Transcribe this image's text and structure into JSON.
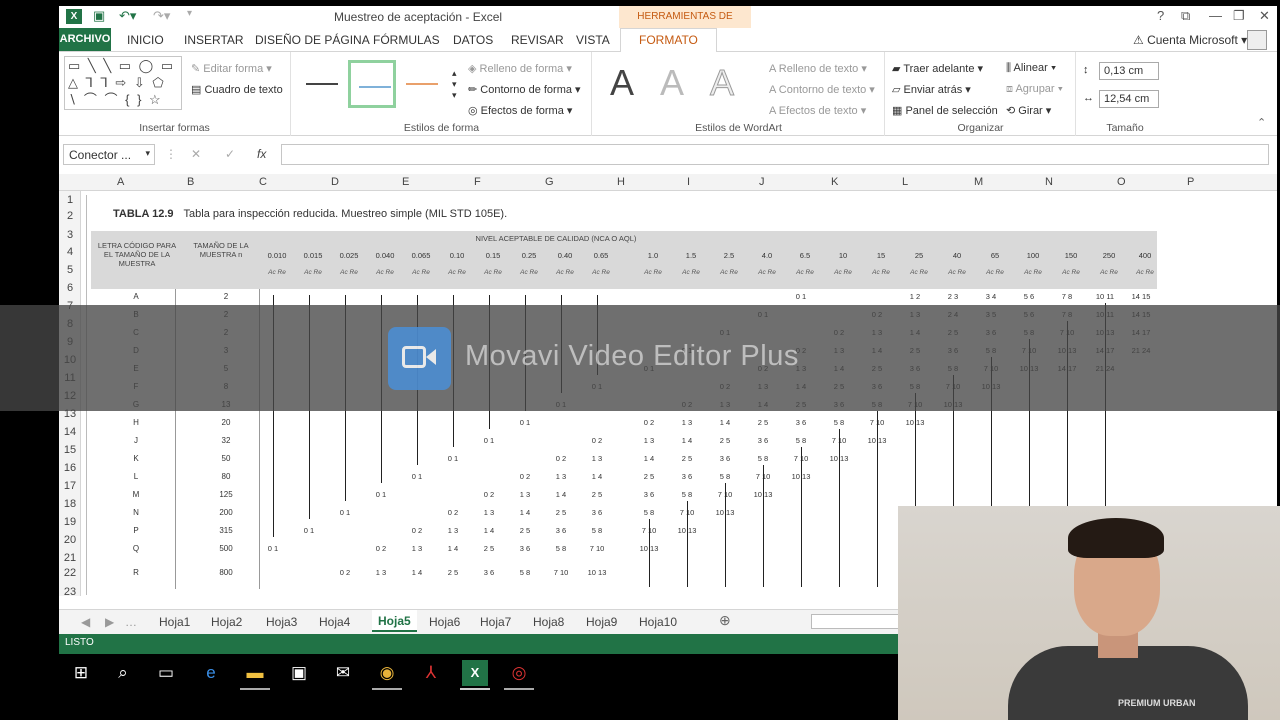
{
  "window": {
    "title": "Muestreo de aceptación - Excel",
    "contextual_group": "HERRAMIENTAS DE DIBUJO",
    "controls": [
      "?",
      "⧉",
      "—",
      "❐",
      "✕"
    ]
  },
  "tabs": {
    "file": "ARCHIVO",
    "items": [
      "INICIO",
      "INSERTAR",
      "DISEÑO DE PÁGINA",
      "FÓRMULAS",
      "DATOS",
      "REVISAR",
      "VISTA"
    ],
    "active": "FORMATO",
    "account": "Cuenta Microsoft"
  },
  "ribbon": {
    "insert_shapes": {
      "label": "Insertar formas",
      "shapes_row1": "▭ ╲ ╲ ▭ ◯ ▭",
      "shapes_row2": "△ ⅂ ⅂ ⇨ ⇩ ⬠",
      "shapes_row3": "∖ ⌒ ⌒ { } ☆",
      "edit_shape": "Editar forma",
      "text_box": "Cuadro de texto"
    },
    "shape_styles": {
      "label": "Estilos de forma",
      "fill": "Relleno de forma",
      "outline": "Contorno de forma",
      "effects": "Efectos de forma"
    },
    "wordart_styles": {
      "label": "Estilos de WordArt",
      "sample": "A",
      "text_fill": "Relleno de texto",
      "text_outline": "Contorno de texto",
      "text_effects": "Efectos de texto"
    },
    "arrange": {
      "label": "Organizar",
      "bring_forward": "Traer adelante",
      "send_backward": "Enviar atrás",
      "selection_pane": "Panel de selección",
      "align": "Alinear",
      "group": "Agrupar",
      "rotate": "Girar"
    },
    "size": {
      "label": "Tamaño",
      "height": "0,13 cm",
      "width": "12,54 cm"
    }
  },
  "formula_bar": {
    "name_box": "Conector ...",
    "fx": "fx",
    "content": ""
  },
  "columns": [
    "A",
    "B",
    "C",
    "D",
    "E",
    "F",
    "G",
    "H",
    "I",
    "J",
    "K",
    "L",
    "M",
    "N",
    "O",
    "P"
  ],
  "rows": [
    "1",
    "2",
    "3",
    "4",
    "5",
    "6",
    "7",
    "8",
    "9",
    "10",
    "11",
    "12",
    "13",
    "14",
    "15",
    "16",
    "17",
    "18",
    "19",
    "20",
    "21",
    "22",
    "23"
  ],
  "table": {
    "number": "TABLA 12.9",
    "title": "Tabla para inspección reducida. Muestreo simple (MIL STD 105E).",
    "col_code": "LETRA CÓDIGO PARA EL TAMAÑO DE LA MUESTRA",
    "col_size": "TAMAÑO DE LA MUESTRA n",
    "aql_header": "NIVEL ACEPTABLE DE CALIDAD (NCA O AQL)",
    "aql_levels": [
      "0.010",
      "0.015",
      "0.025",
      "0.040",
      "0.065",
      "0.10",
      "0.15",
      "0.25",
      "0.40",
      "0.65",
      "1.0",
      "1.5",
      "2.5",
      "4.0",
      "6.5",
      "10",
      "15",
      "25",
      "40",
      "65",
      "100",
      "150",
      "250",
      "400"
    ],
    "acre": "Ac Re",
    "rows": [
      {
        "code": "A",
        "n": "2",
        "vals": {
          "14": "0 1",
          "17": "1 2",
          "18": "2 3",
          "19": "3 4",
          "20": "5 6",
          "21": "7 8",
          "22": "10 11",
          "23": "14 15"
        }
      },
      {
        "code": "B",
        "n": "2",
        "vals": {
          "13": "0 1",
          "16": "0 2",
          "17": "1 3",
          "18": "2 4",
          "19": "3 5",
          "20": "5 6",
          "21": "7 8",
          "22": "10 11",
          "23": "14 15"
        }
      },
      {
        "code": "C",
        "n": "2",
        "vals": {
          "12": "0 1",
          "15": "0 2",
          "16": "1 3",
          "17": "1 4",
          "18": "2 5",
          "19": "3 6",
          "20": "5 8",
          "21": "7 10",
          "22": "10 13",
          "23": "14 17"
        }
      },
      {
        "code": "D",
        "n": "3",
        "vals": {
          "11": "0 1",
          "14": "0 2",
          "15": "1 3",
          "16": "1 4",
          "17": "2 5",
          "18": "3 6",
          "19": "5 8",
          "20": "7 10",
          "21": "10 13",
          "22": "14 17",
          "23": "21 24"
        }
      },
      {
        "code": "E",
        "n": "5",
        "vals": {
          "10": "0 1",
          "13": "0 2",
          "14": "1 3",
          "15": "1 4",
          "16": "2 5",
          "17": "3 6",
          "18": "5 8",
          "19": "7 10",
          "20": "10 13",
          "21": "14 17",
          "22": "21 24"
        }
      },
      {
        "code": "F",
        "n": "8",
        "vals": {
          "9": "0 1",
          "12": "0 2",
          "13": "1 3",
          "14": "1 4",
          "15": "2 5",
          "16": "3 6",
          "17": "5 8",
          "18": "7 10",
          "19": "10 13"
        }
      },
      {
        "code": "G",
        "n": "13",
        "vals": {
          "8": "0 1",
          "11": "0 2",
          "12": "1 3",
          "13": "1 4",
          "14": "2 5",
          "15": "3 6",
          "16": "5 8",
          "17": "7 10",
          "18": "10 13"
        }
      },
      {
        "code": "H",
        "n": "20",
        "vals": {
          "7": "0 1",
          "10": "0 2",
          "11": "1 3",
          "12": "1 4",
          "13": "2 5",
          "14": "3 6",
          "15": "5 8",
          "16": "7 10",
          "17": "10 13"
        }
      },
      {
        "code": "J",
        "n": "32",
        "vals": {
          "6": "0 1",
          "9": "0 2",
          "10": "1 3",
          "11": "1 4",
          "12": "2 5",
          "13": "3 6",
          "14": "5 8",
          "15": "7 10",
          "16": "10 13"
        }
      },
      {
        "code": "K",
        "n": "50",
        "vals": {
          "5": "0 1",
          "8": "0 2",
          "9": "1 3",
          "10": "1 4",
          "11": "2 5",
          "12": "3 6",
          "13": "5 8",
          "14": "7 10",
          "15": "10 13"
        }
      },
      {
        "code": "L",
        "n": "80",
        "vals": {
          "4": "0 1",
          "7": "0 2",
          "8": "1 3",
          "9": "1 4",
          "10": "2 5",
          "11": "3 6",
          "12": "5 8",
          "13": "7 10",
          "14": "10 13"
        }
      },
      {
        "code": "M",
        "n": "125",
        "vals": {
          "3": "0 1",
          "6": "0 2",
          "7": "1 3",
          "8": "1 4",
          "9": "2 5",
          "10": "3 6",
          "11": "5 8",
          "12": "7 10",
          "13": "10 13"
        }
      },
      {
        "code": "N",
        "n": "200",
        "vals": {
          "2": "0 1",
          "5": "0 2",
          "6": "1 3",
          "7": "1 4",
          "8": "2 5",
          "9": "3 6",
          "10": "5 8",
          "11": "7 10",
          "12": "10 13"
        }
      },
      {
        "code": "P",
        "n": "315",
        "vals": {
          "1": "0 1",
          "4": "0 2",
          "5": "1 3",
          "6": "1 4",
          "7": "2 5",
          "8": "3 6",
          "9": "5 8",
          "10": "7 10",
          "11": "10 13"
        }
      },
      {
        "code": "Q",
        "n": "500",
        "vals": {
          "0": "0 1",
          "3": "0 2",
          "4": "1 3",
          "5": "1 4",
          "6": "2 5",
          "7": "3 6",
          "8": "5 8",
          "9": "7 10",
          "10": "10 13"
        }
      },
      {
        "code": "R",
        "n": "800",
        "vals": {
          "2": "0 2",
          "3": "1 3",
          "4": "1 4",
          "5": "2 5",
          "6": "3 6",
          "7": "5 8",
          "8": "7 10",
          "9": "10 13"
        }
      }
    ]
  },
  "sheets": [
    "Hoja1",
    "Hoja2",
    "Hoja3",
    "Hoja4",
    "Hoja5",
    "Hoja6",
    "Hoja7",
    "Hoja8",
    "Hoja9",
    "Hoja10"
  ],
  "active_sheet": "Hoja5",
  "status": "LISTO",
  "watermark": "Movavi Video Editor Plus",
  "webcam_shirt_text": "PREMIUM URBAN"
}
